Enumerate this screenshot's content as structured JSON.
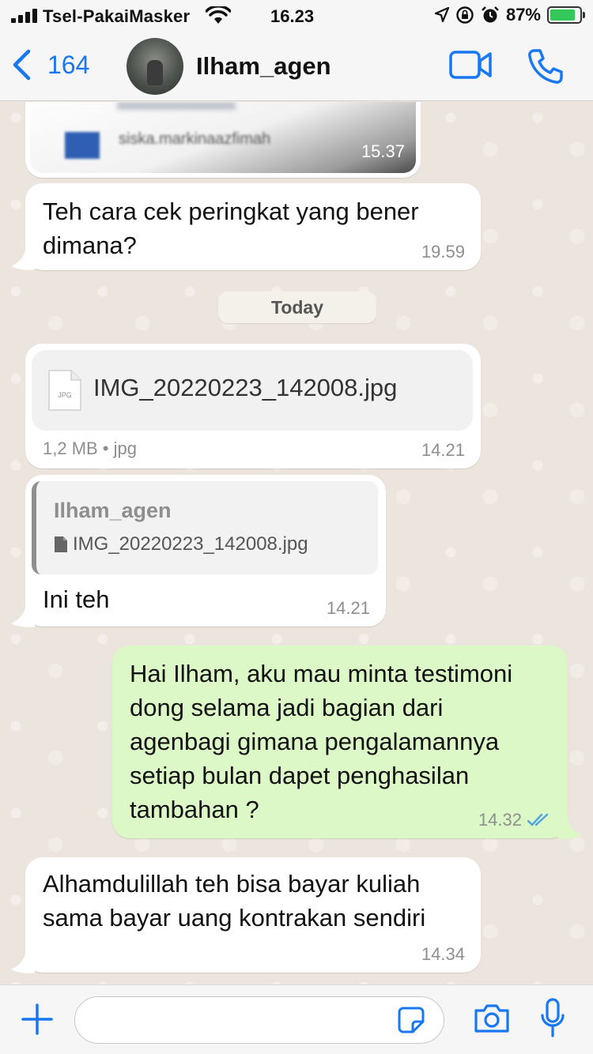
{
  "status_bar": {
    "carrier": "Tsel-PakaiMasker",
    "time": "16.23",
    "battery_percent": "87%",
    "battery_level": 0.87,
    "colors": {
      "battery": "#34c759"
    }
  },
  "header": {
    "back_count": "164",
    "contact_name": "Ilham_agen",
    "icons": [
      "chevron-left-icon",
      "video-camera-icon",
      "phone-icon"
    ],
    "accent_color": "#1877f2"
  },
  "messages": {
    "image_preview": {
      "blurred_name": "siska.markinaazfimah",
      "time": "15.37"
    },
    "msg_question": {
      "text_line1": "Teh cara cek peringkat yang bener",
      "text_line2": "dimana?",
      "time": "19.59"
    },
    "date_separator": "Today",
    "file_message": {
      "file_icon_label": "JPG",
      "file_name": "IMG_20220223_142008.jpg",
      "meta": "1,2 MB • jpg",
      "time": "14.21"
    },
    "reply_message": {
      "quoted_name": "Ilham_agen",
      "quoted_file": "IMG_20220223_142008.jpg",
      "text": "Ini teh",
      "time": "14.21"
    },
    "outgoing_message": {
      "line1": "Hai Ilham, aku mau minta testimoni",
      "line2": "dong selama jadi bagian dari",
      "line3": "agenbagi gimana pengalamannya",
      "line4": "setiap bulan dapet penghasilan",
      "line5": "tambahan ?",
      "time": "14.32",
      "status": "read"
    },
    "reply_answer": {
      "line1": "Alhamdulillah teh bisa bayar kuliah",
      "line2": "sama bayar uang kontrakan sendiri",
      "time": "14.34"
    }
  },
  "input_bar": {
    "placeholder": "",
    "icons": [
      "plus-icon",
      "sticker-icon",
      "camera-icon",
      "microphone-icon"
    ]
  },
  "colors": {
    "chat_background": "#ece5dd",
    "incoming_bubble": "#ffffff",
    "outgoing_bubble": "#dcf8c6",
    "read_ticks": "#4fa3e0"
  }
}
